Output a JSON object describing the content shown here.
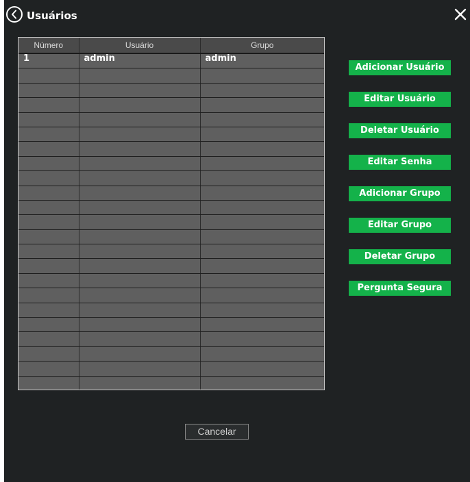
{
  "window": {
    "title": "Usuários"
  },
  "users_table": {
    "columns": [
      "Número",
      "Usuário",
      "Grupo"
    ],
    "rows": [
      [
        "1",
        "admin",
        "admin"
      ],
      [
        "",
        "",
        ""
      ],
      [
        "",
        "",
        ""
      ],
      [
        "",
        "",
        ""
      ],
      [
        "",
        "",
        ""
      ],
      [
        "",
        "",
        ""
      ],
      [
        "",
        "",
        ""
      ],
      [
        "",
        "",
        ""
      ],
      [
        "",
        "",
        ""
      ],
      [
        "",
        "",
        ""
      ],
      [
        "",
        "",
        ""
      ],
      [
        "",
        "",
        ""
      ],
      [
        "",
        "",
        ""
      ],
      [
        "",
        "",
        ""
      ],
      [
        "",
        "",
        ""
      ],
      [
        "",
        "",
        ""
      ],
      [
        "",
        "",
        ""
      ],
      [
        "",
        "",
        ""
      ],
      [
        "",
        "",
        ""
      ],
      [
        "",
        "",
        ""
      ],
      [
        "",
        "",
        ""
      ],
      [
        "",
        "",
        ""
      ],
      [
        "",
        "",
        ""
      ],
      [
        "",
        "",
        ""
      ]
    ]
  },
  "actions": [
    {
      "name": "add-user-button",
      "label": "Adicionar Usuário"
    },
    {
      "name": "edit-user-button",
      "label": "Editar Usuário"
    },
    {
      "name": "delete-user-button",
      "label": "Deletar Usuário"
    },
    {
      "name": "edit-password-button",
      "label": "Editar Senha"
    },
    {
      "name": "add-group-button",
      "label": "Adicionar Grupo"
    },
    {
      "name": "edit-group-button",
      "label": "Editar Grupo"
    },
    {
      "name": "delete-group-button",
      "label": "Deletar Grupo"
    },
    {
      "name": "security-question-button",
      "label": "Pergunta Segura"
    }
  ],
  "footer": {
    "cancel_label": "Cancelar"
  },
  "colors": {
    "background": "#1f2223",
    "accent_green": "#14b24a",
    "table_cell": "#5f5f5f",
    "table_header": "#4a4a4a"
  },
  "icons": {
    "back": "chevron-left-circle-icon",
    "close": "close-icon"
  }
}
